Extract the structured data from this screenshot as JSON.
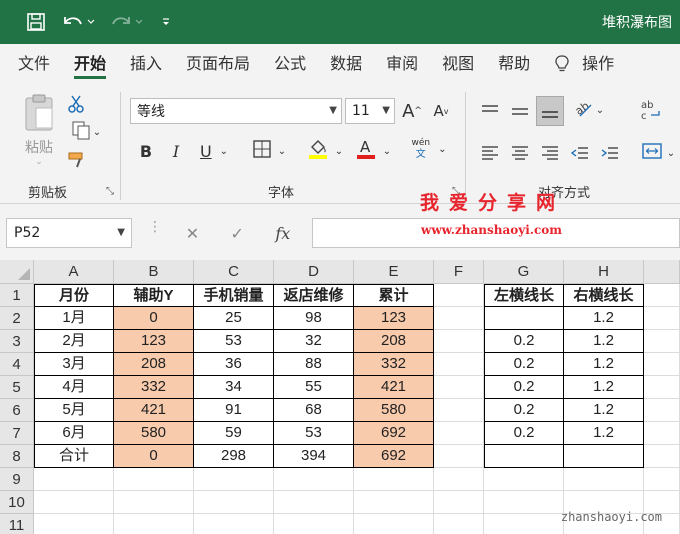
{
  "app": {
    "title": "堆积瀑布图",
    "quick_access": [
      "save-icon",
      "undo-icon",
      "redo-icon",
      "customize-icon"
    ]
  },
  "tabs": [
    "文件",
    "开始",
    "插入",
    "页面布局",
    "公式",
    "数据",
    "审阅",
    "视图",
    "帮助",
    "操作"
  ],
  "active_tab": "开始",
  "ribbon": {
    "clipboard": {
      "label": "剪贴板",
      "paste": "粘贴"
    },
    "font": {
      "label": "字体",
      "name": "等线",
      "size": "11",
      "phonetic_top": "wén",
      "phonetic_bottom": "文"
    },
    "align": {
      "label": "对齐方式"
    }
  },
  "formula_bar": {
    "name_box": "P52",
    "fx": "fx",
    "value": ""
  },
  "watermark": {
    "brand": "我爱分享网",
    "url_top": "www.zhanshaoyi.com",
    "url_bottom": "zhanshaoyi.com"
  },
  "sheet": {
    "columns": [
      "A",
      "B",
      "C",
      "D",
      "E",
      "F",
      "G",
      "H"
    ],
    "rows": [
      "1",
      "2",
      "3",
      "4",
      "5",
      "6",
      "7",
      "8",
      "9",
      "10",
      "11"
    ],
    "table_main": {
      "headers": [
        "月份",
        "辅助Y",
        "手机销量",
        "返店维修",
        "累计"
      ],
      "rows": [
        [
          "1月",
          "0",
          "25",
          "98",
          "123"
        ],
        [
          "2月",
          "123",
          "53",
          "32",
          "208"
        ],
        [
          "3月",
          "208",
          "36",
          "88",
          "332"
        ],
        [
          "4月",
          "332",
          "34",
          "55",
          "421"
        ],
        [
          "5月",
          "421",
          "91",
          "68",
          "580"
        ],
        [
          "6月",
          "580",
          "59",
          "53",
          "692"
        ],
        [
          "合计",
          "0",
          "298",
          "394",
          "692"
        ]
      ]
    },
    "table_side": {
      "headers": [
        "左横线长",
        "右横线长"
      ],
      "rows": [
        [
          "",
          "1.2"
        ],
        [
          "0.2",
          "1.2"
        ],
        [
          "0.2",
          "1.2"
        ],
        [
          "0.2",
          "1.2"
        ],
        [
          "0.2",
          "1.2"
        ],
        [
          "0.2",
          "1.2"
        ],
        [
          "",
          ""
        ]
      ]
    }
  },
  "colors": {
    "excel_green": "#217346",
    "highlight": "#f8cbad"
  }
}
